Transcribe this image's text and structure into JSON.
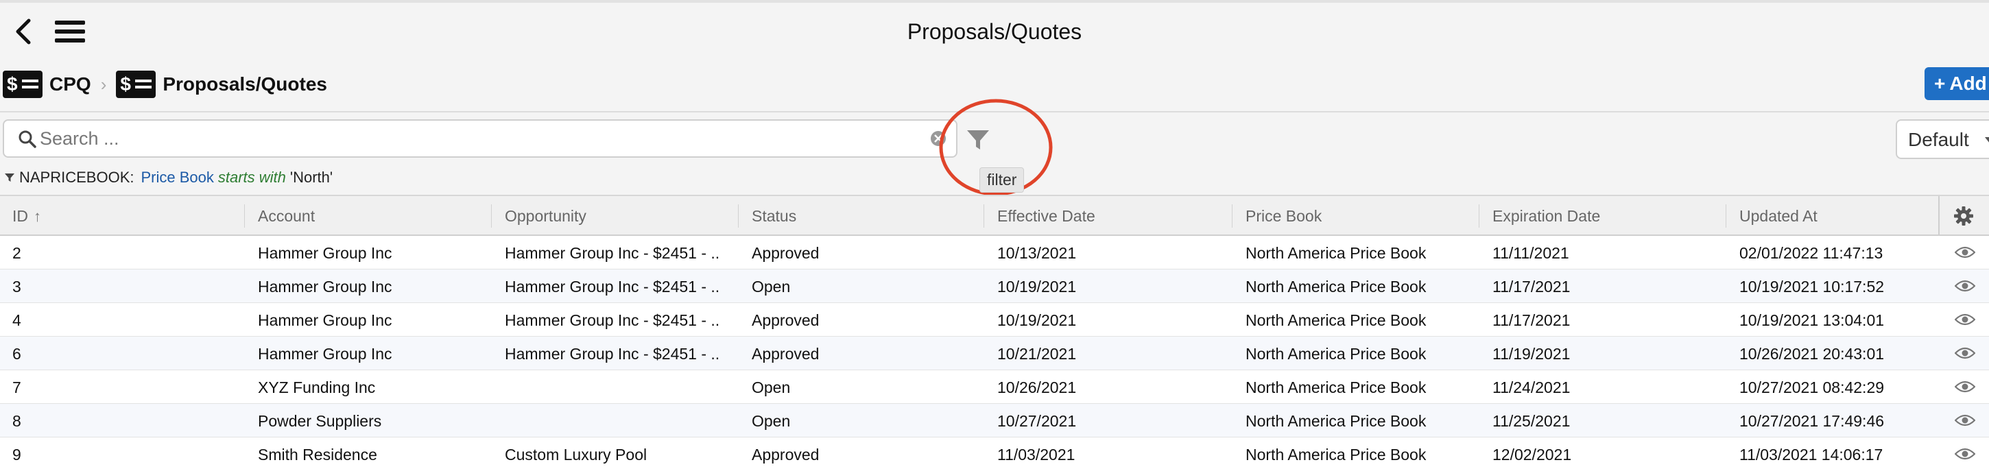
{
  "header": {
    "title": "Proposals/Quotes"
  },
  "breadcrumb": [
    {
      "label": "CPQ",
      "icon": "dollar-list-icon"
    },
    {
      "label": "Proposals/Quotes",
      "icon": "dollar-list-icon"
    }
  ],
  "toolbar": {
    "add_label": "Add",
    "search_placeholder": "Search ...",
    "filter_tooltip": "filter",
    "view_select": "Default"
  },
  "active_filter": {
    "field": "NAPRICEBOOK:",
    "name": "Price Book",
    "operator": "starts with",
    "value": "'North'"
  },
  "colors": {
    "accent": "#1f6fc5",
    "highlight": "#e0442a",
    "chip_name": "#1c5aa6",
    "chip_op": "#2e7d32"
  },
  "table": {
    "columns": [
      "ID",
      "Account",
      "Opportunity",
      "Status",
      "Effective Date",
      "Price Book",
      "Expiration Date",
      "Updated At"
    ],
    "sort": {
      "column": "ID",
      "direction": "ascending"
    },
    "rows": [
      [
        "2",
        "Hammer Group Inc",
        "Hammer Group Inc - $2451 - ...",
        "Approved",
        "10/13/2021",
        "North America Price Book",
        "11/11/2021",
        "02/01/2022 11:47:13"
      ],
      [
        "3",
        "Hammer Group Inc",
        "Hammer Group Inc - $2451 - ...",
        "Open",
        "10/19/2021",
        "North America Price Book",
        "11/17/2021",
        "10/19/2021 10:17:52"
      ],
      [
        "4",
        "Hammer Group Inc",
        "Hammer Group Inc - $2451 - ...",
        "Approved",
        "10/19/2021",
        "North America Price Book",
        "11/17/2021",
        "10/19/2021 13:04:01"
      ],
      [
        "6",
        "Hammer Group Inc",
        "Hammer Group Inc - $2451 - ...",
        "Approved",
        "10/21/2021",
        "North America Price Book",
        "11/19/2021",
        "10/26/2021 20:43:01"
      ],
      [
        "7",
        "XYZ Funding Inc",
        "",
        "Open",
        "10/26/2021",
        "North America Price Book",
        "11/24/2021",
        "10/27/2021 08:42:29"
      ],
      [
        "8",
        "Powder Suppliers",
        "",
        "Open",
        "10/27/2021",
        "North America Price Book",
        "11/25/2021",
        "10/27/2021 17:49:46"
      ],
      [
        "9",
        "Smith Residence",
        "Custom Luxury Pool",
        "Approved",
        "11/03/2021",
        "North America Price Book",
        "12/02/2021",
        "11/03/2021 14:06:17"
      ]
    ]
  }
}
